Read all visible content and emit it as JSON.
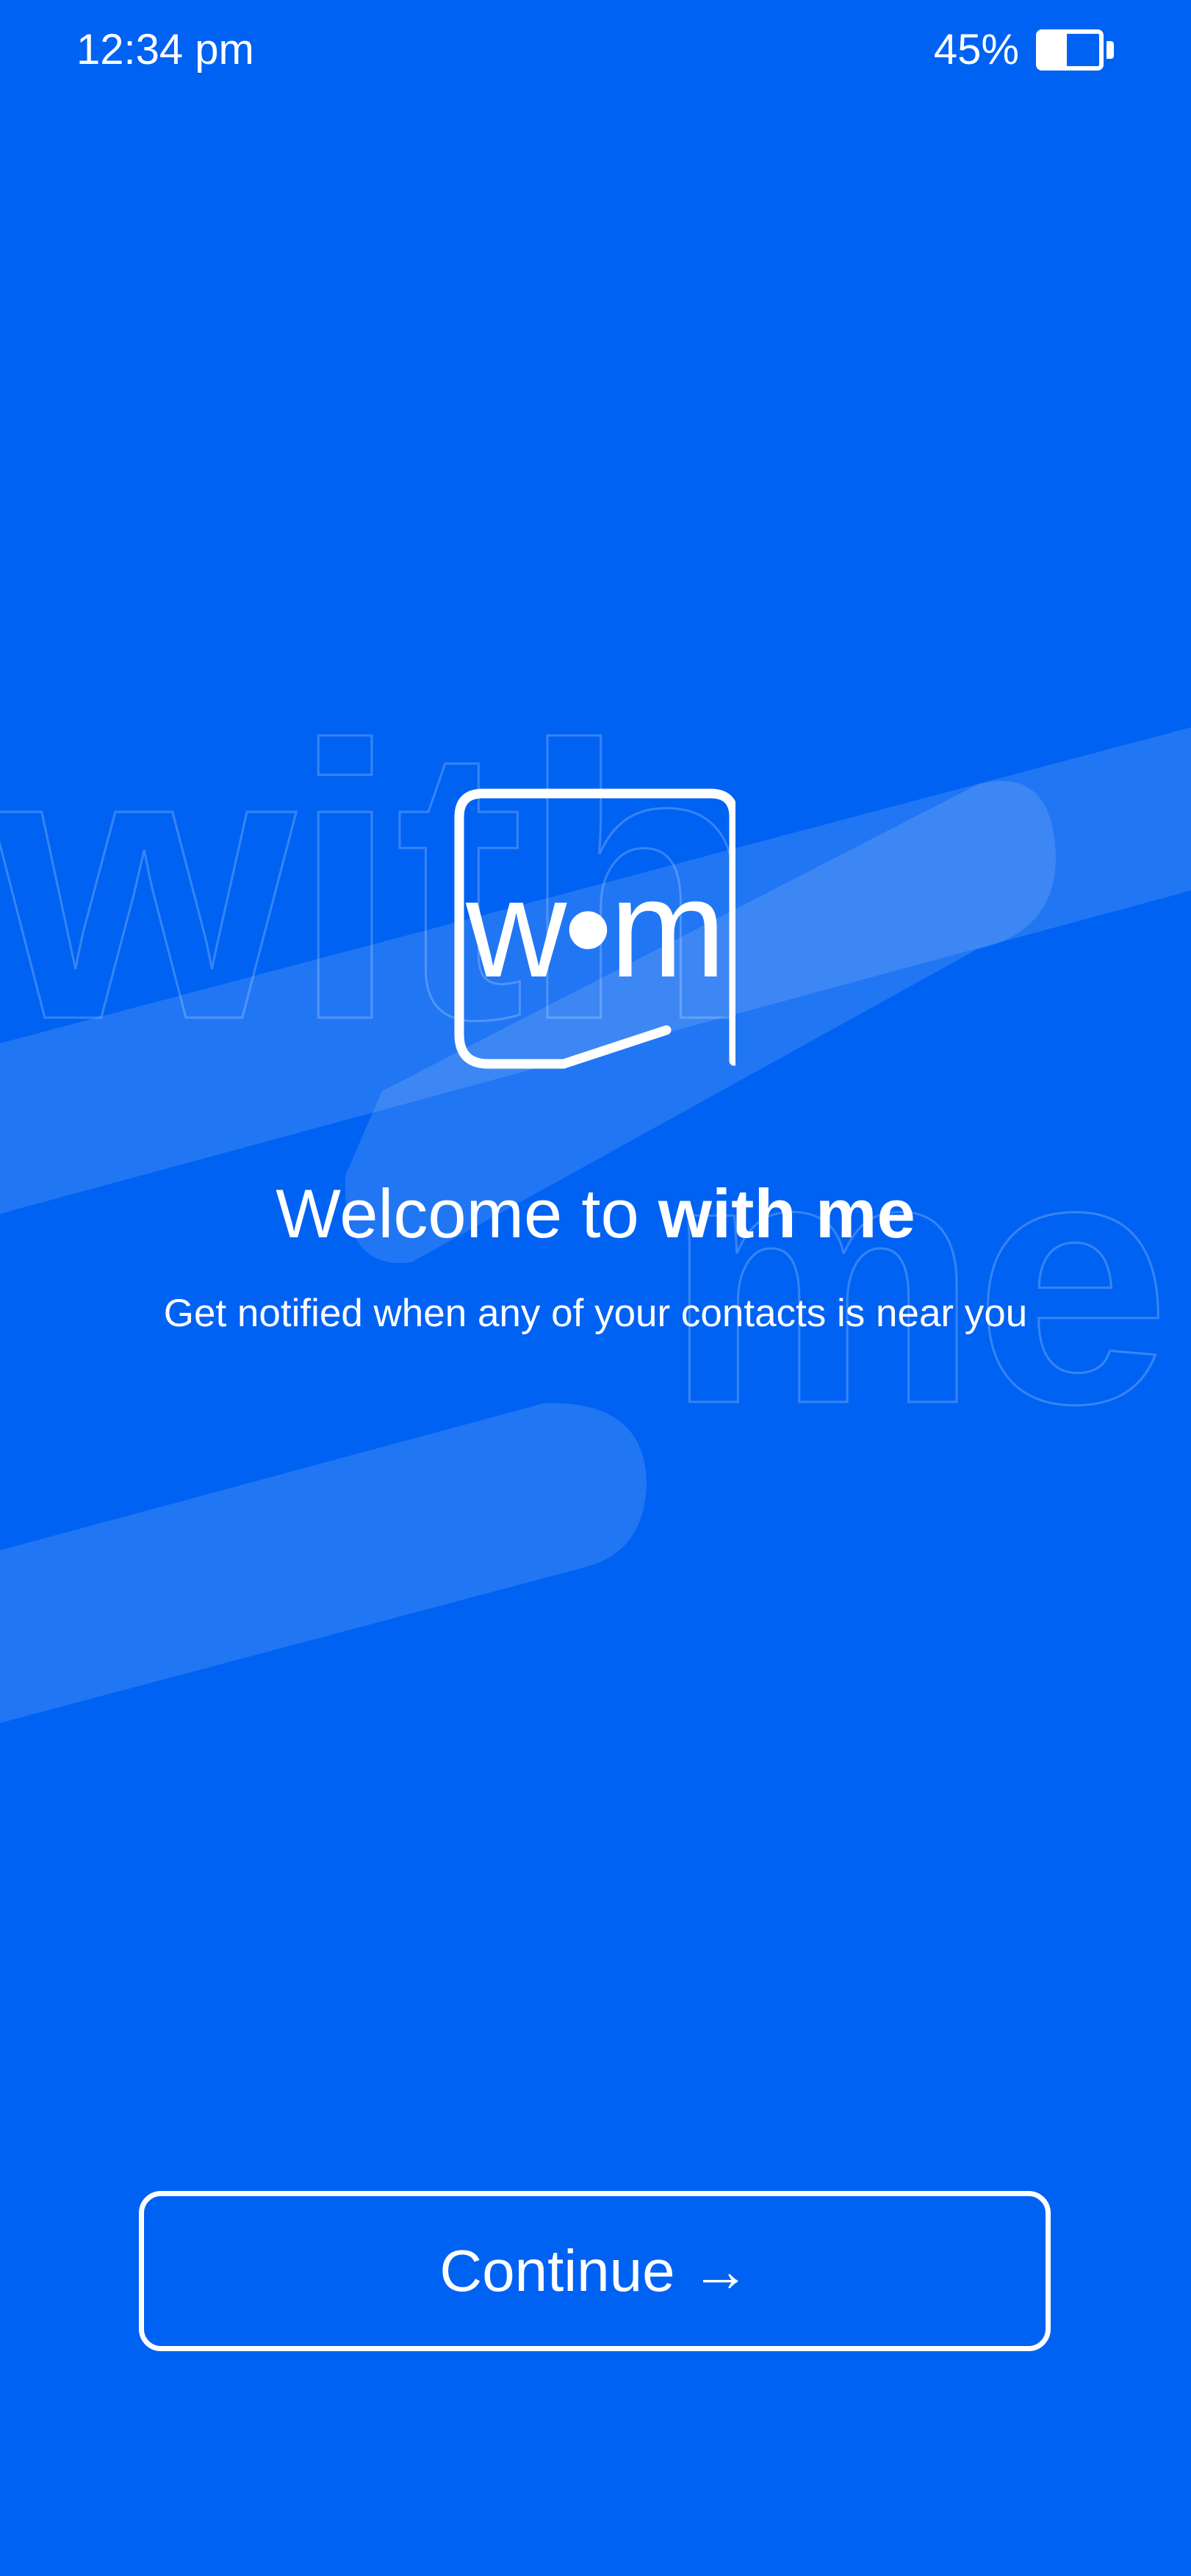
{
  "status_bar": {
    "time": "12:34 pm",
    "battery_percent_label": "45%",
    "battery_level": 0.45
  },
  "background": {
    "watermark_words": [
      "with",
      "me"
    ]
  },
  "logo": {
    "left": "w",
    "dot": "•",
    "right": "m"
  },
  "welcome": {
    "title_prefix": "Welcome to ",
    "title_brand": "with me",
    "subtitle": "Get notified when any of your contacts is near you"
  },
  "continue_button": {
    "label": "Continue",
    "arrow": "→"
  },
  "colors": {
    "background": "#0062F3",
    "foreground": "#FFFFFF",
    "band": "#2E7CF5"
  },
  "icons": [
    "battery-icon",
    "arrow-right-icon"
  ]
}
